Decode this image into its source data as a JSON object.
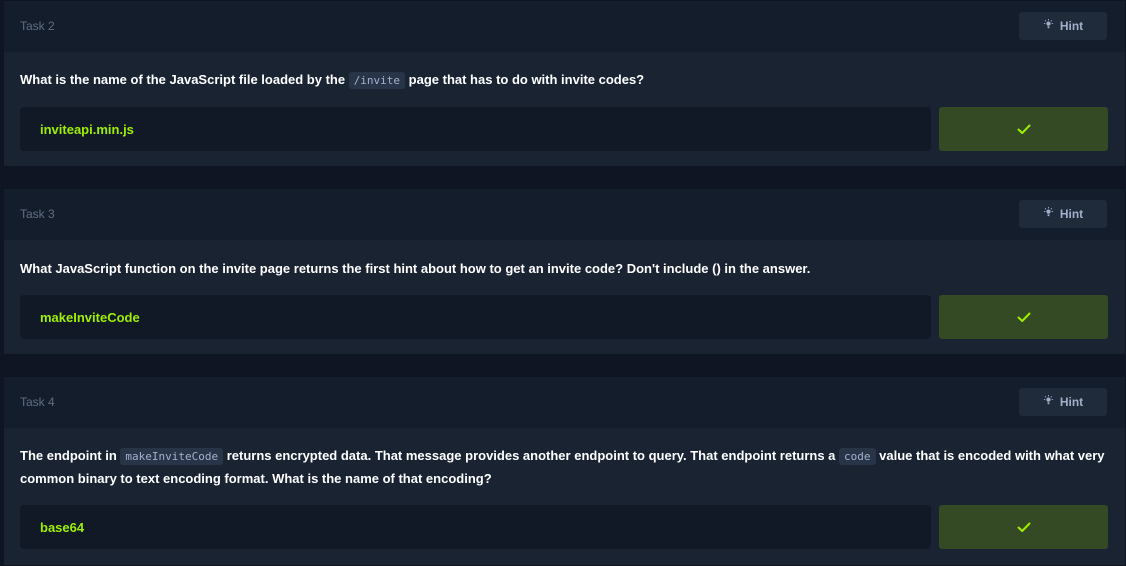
{
  "colors": {
    "accent": "#9fef00",
    "panel": "#1a2332",
    "header": "#141d2b"
  },
  "hint_label": "Hint",
  "tasks": [
    {
      "title": "Task 2",
      "question": {
        "before": "What is the name of the JavaScript file loaded by the ",
        "code": "/invite",
        "after": " page that has to do with invite codes?"
      },
      "answer": "inviteapi.min.js"
    },
    {
      "title": "Task 3",
      "question": {
        "text": "What JavaScript function on the invite page returns the first hint about how to get an invite code? Don't include () in the answer."
      },
      "answer": "makeInviteCode"
    },
    {
      "title": "Task 4",
      "question": {
        "before": "The endpoint in ",
        "code": "makeInviteCode",
        "middle": " returns encrypted data. That message provides another endpoint to query. That endpoint returns a ",
        "code2": "code",
        "after": " value that is encoded with what very common binary to text encoding format. What is the name of that encoding?"
      },
      "answer": "base64"
    }
  ]
}
